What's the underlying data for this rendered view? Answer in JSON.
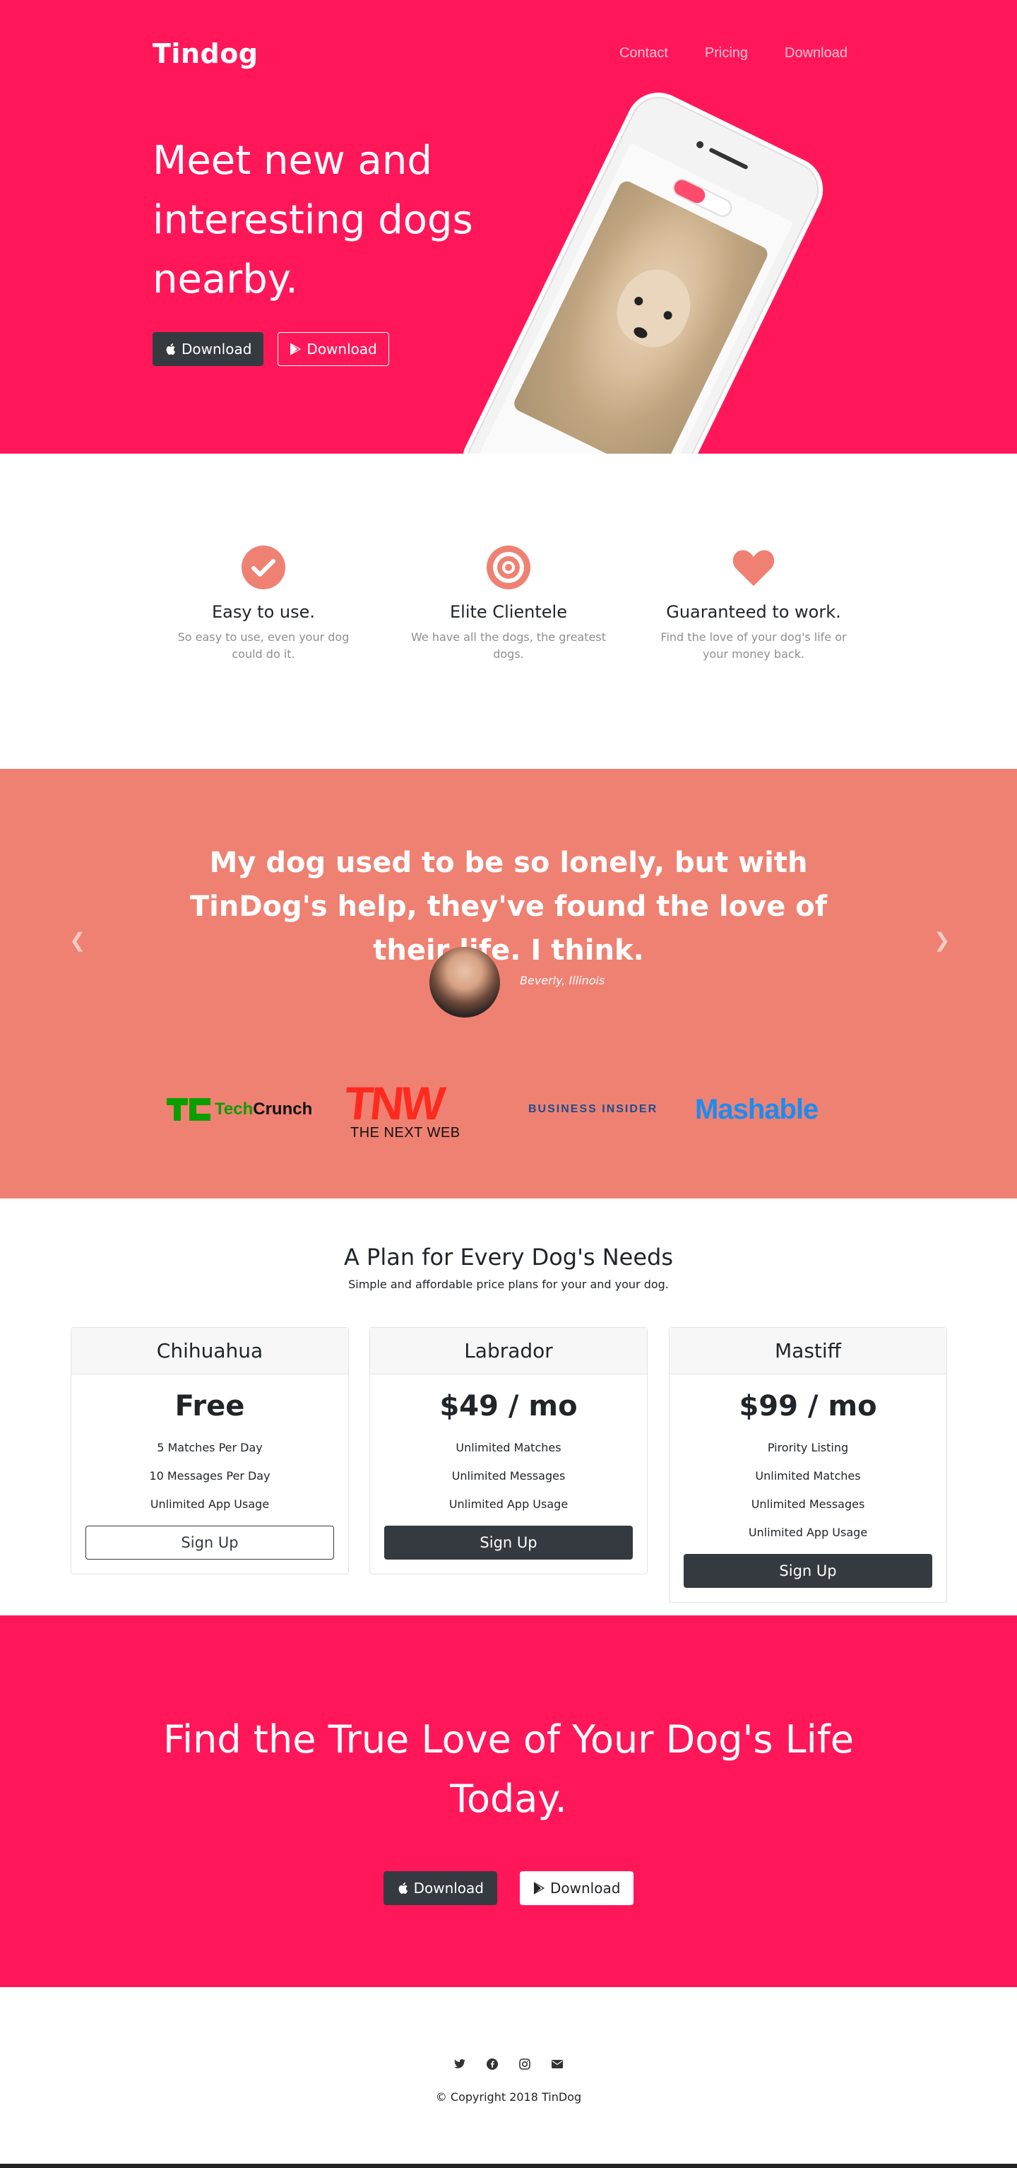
{
  "title_section": {
    "brand": "Tindog",
    "nav": [
      "Contact",
      "Pricing",
      "Download"
    ],
    "heading": "Meet new and interesting dogs nearby.",
    "buttons": {
      "apple": "Download",
      "google": "Download"
    }
  },
  "features": [
    {
      "icon": "check-circle-icon",
      "title": "Easy to use.",
      "text": "So easy to use, even your dog could do it."
    },
    {
      "icon": "bullseye-icon",
      "title": "Elite Clientele",
      "text": "We have all the dogs, the greatest dogs."
    },
    {
      "icon": "heart-icon",
      "title": "Guaranteed to work.",
      "text": "Find the love of your dog's life or your money back."
    }
  ],
  "testimonial": {
    "quote": "My dog used to be so lonely, but with TinDog's help, they've found the love of their life. I think.",
    "cite": "Beverly, Illinois"
  },
  "press": [
    "TechCrunch",
    "TNW",
    "THE NEXT WEB",
    "BUSINESS INSIDER",
    "Mashable"
  ],
  "pricing": {
    "title": "A Plan for Every Dog's Needs",
    "subtitle": "Simple and affordable price plans for your and your dog.",
    "plans": [
      {
        "name": "Chihuahua",
        "price": "Free",
        "features": [
          "5 Matches Per Day",
          "10 Messages Per Day",
          "Unlimited App Usage"
        ],
        "button": "Sign Up"
      },
      {
        "name": "Labrador",
        "price": "$49 / mo",
        "features": [
          "Unlimited Matches",
          "Unlimited Messages",
          "Unlimited App Usage"
        ],
        "button": "Sign Up"
      },
      {
        "name": "Mastiff",
        "price": "$99 / mo",
        "features": [
          "Pirority Listing",
          "Unlimited Matches",
          "Unlimited Messages",
          "Unlimited App Usage"
        ],
        "button": "Sign Up"
      }
    ]
  },
  "cta": {
    "heading": "Find the True Love of Your Dog's Life Today.",
    "buttons": {
      "apple": "Download",
      "google": "Download"
    }
  },
  "footer": {
    "social_icons": [
      "twitter-icon",
      "facebook-icon",
      "instagram-icon",
      "envelope-icon"
    ],
    "copyright": "© Copyright 2018 TinDog"
  },
  "colors": {
    "primary": "#ff1759",
    "coral": "#ef8172",
    "dark": "#343a40",
    "icon": "#ef8172"
  }
}
